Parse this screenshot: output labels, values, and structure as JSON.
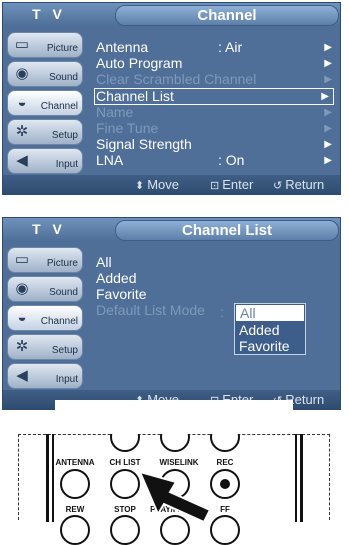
{
  "screen1": {
    "tv_label": "T V",
    "title": "Channel",
    "sidebar": [
      {
        "label": "Picture",
        "icon": "picture-icon"
      },
      {
        "label": "Sound",
        "icon": "sound-icon"
      },
      {
        "label": "Channel",
        "icon": "channel-icon"
      },
      {
        "label": "Setup",
        "icon": "setup-icon"
      },
      {
        "label": "Input",
        "icon": "input-icon"
      }
    ],
    "menu": [
      {
        "label": "Antenna",
        "value": ": Air",
        "arrow": "▶"
      },
      {
        "label": "Auto Program",
        "value": "",
        "arrow": "▶"
      },
      {
        "label": "Clear Scrambled Channel",
        "value": "",
        "arrow": "▶"
      },
      {
        "label": "Channel List",
        "value": "",
        "arrow": "▶"
      },
      {
        "label": "Name",
        "value": "",
        "arrow": "▶"
      },
      {
        "label": "Fine Tune",
        "value": "",
        "arrow": "▶"
      },
      {
        "label": "Signal Strength",
        "value": "",
        "arrow": "▶"
      },
      {
        "label": "LNA",
        "value": ": On",
        "arrow": "▶"
      }
    ],
    "footer": {
      "move": "Move",
      "enter": "Enter",
      "return": "Return"
    }
  },
  "screen2": {
    "tv_label": "T V",
    "title": "Channel List",
    "sidebar": [
      {
        "label": "Picture",
        "icon": "picture-icon"
      },
      {
        "label": "Sound",
        "icon": "sound-icon"
      },
      {
        "label": "Channel",
        "icon": "channel-icon"
      },
      {
        "label": "Setup",
        "icon": "setup-icon"
      },
      {
        "label": "Input",
        "icon": "input-icon"
      }
    ],
    "menu": [
      {
        "label": "All"
      },
      {
        "label": "Added"
      },
      {
        "label": "Favorite"
      },
      {
        "label": "Default List Mode"
      }
    ],
    "colon": ":",
    "dropdown_options": [
      "All",
      "Added",
      "Favorite"
    ],
    "footer": {
      "move": "Move",
      "enter": "Enter",
      "return": "Return"
    }
  },
  "remote": {
    "labels": [
      "ANTENNA",
      "CH LIST",
      "WISELINK",
      "REC",
      "REW",
      "STOP",
      "PLAY/PAUSE",
      "FF"
    ]
  },
  "colors": {
    "osd_bg": "#4f6f98",
    "disabled_text": "#7f99bb",
    "dropdown_selected": "#3d5e8a"
  }
}
